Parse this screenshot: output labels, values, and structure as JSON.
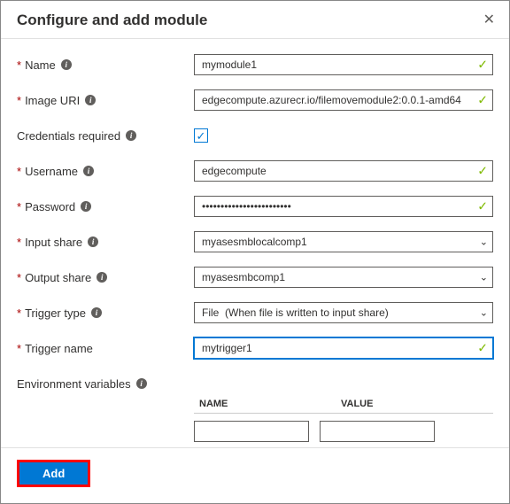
{
  "header": {
    "title": "Configure and add module"
  },
  "fields": {
    "name": {
      "label": "Name",
      "value": "mymodule1",
      "required": true
    },
    "imageUri": {
      "label": "Image URI",
      "value": "edgecompute.azurecr.io/filemovemodule2:0.0.1-amd64",
      "required": true
    },
    "credsRequired": {
      "label": "Credentials required",
      "checked": true,
      "required": false
    },
    "username": {
      "label": "Username",
      "value": "edgecompute",
      "required": true
    },
    "password": {
      "label": "Password",
      "value": "••••••••••••••••••••••••",
      "required": true
    },
    "inputShare": {
      "label": "Input share",
      "value": "myasesmblocalcomp1",
      "required": true
    },
    "outputShare": {
      "label": "Output share",
      "value": "myasesmbcomp1",
      "required": true
    },
    "triggerType": {
      "label": "Trigger type",
      "value": "File  (When file is written to input share)",
      "required": true
    },
    "triggerName": {
      "label": "Trigger name",
      "value": "mytrigger1",
      "required": true
    },
    "envVars": {
      "label": "Environment variables",
      "required": false
    }
  },
  "envTable": {
    "headers": {
      "name": "NAME",
      "value": "VALUE"
    },
    "rows": [
      {
        "name": "",
        "value": ""
      }
    ]
  },
  "footer": {
    "addLabel": "Add"
  }
}
